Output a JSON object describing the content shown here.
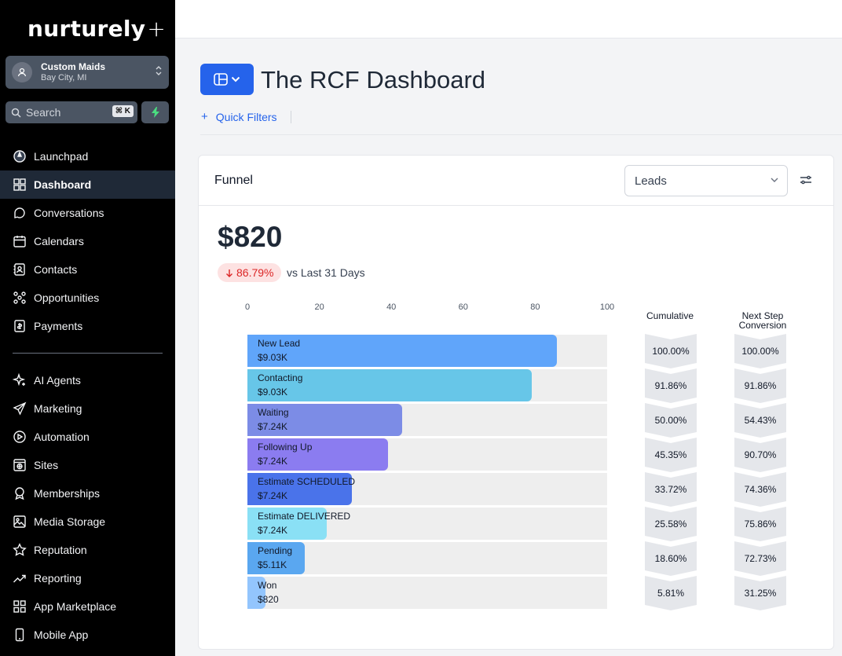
{
  "brand": {
    "logo_text": "nurturely",
    "logo_plus": "+"
  },
  "account": {
    "name": "Custom Maids",
    "location": "Bay City, MI"
  },
  "search": {
    "placeholder": "Search",
    "shortcut": "⌘ K"
  },
  "nav": {
    "primary": [
      {
        "label": "Launchpad",
        "icon": "launchpad-icon"
      },
      {
        "label": "Dashboard",
        "icon": "dashboard-icon",
        "active": true
      },
      {
        "label": "Conversations",
        "icon": "chat-icon"
      },
      {
        "label": "Calendars",
        "icon": "calendar-icon"
      },
      {
        "label": "Contacts",
        "icon": "contacts-icon"
      },
      {
        "label": "Opportunities",
        "icon": "opportunities-icon"
      },
      {
        "label": "Payments",
        "icon": "payments-icon"
      }
    ],
    "secondary": [
      {
        "label": "AI Agents",
        "icon": "sparkle-icon"
      },
      {
        "label": "Marketing",
        "icon": "send-icon"
      },
      {
        "label": "Automation",
        "icon": "automation-icon"
      },
      {
        "label": "Sites",
        "icon": "sites-icon"
      },
      {
        "label": "Memberships",
        "icon": "badge-icon"
      },
      {
        "label": "Media Storage",
        "icon": "image-icon"
      },
      {
        "label": "Reputation",
        "icon": "star-icon"
      },
      {
        "label": "Reporting",
        "icon": "trend-icon"
      },
      {
        "label": "App Marketplace",
        "icon": "apps-icon"
      },
      {
        "label": "Mobile App",
        "icon": "mobile-icon"
      }
    ]
  },
  "page": {
    "title": "The RCF Dashboard",
    "quick_filters": "Quick Filters"
  },
  "card": {
    "title": "Funnel",
    "select_value": "Leads",
    "metric": "$820",
    "change": "86.79%",
    "change_direction": "down",
    "comparison": "vs Last 31 Days",
    "col_cumulative": "Cumulative",
    "col_next_step_1": "Next Step",
    "col_next_step_2": "Conversion"
  },
  "colors": {
    "accent": "#2563eb",
    "negative": "#dc2626",
    "stages": [
      "#60a5fa",
      "#67c6e8",
      "#7c8ce6",
      "#8b7cf0",
      "#4a73ea",
      "#8ae0f5",
      "#5aa7f0",
      "#93c5fd"
    ]
  },
  "chart_data": {
    "type": "bar",
    "orientation": "horizontal",
    "x_ticks": [
      "0",
      "20",
      "40",
      "60",
      "80",
      "100"
    ],
    "xlim": [
      0,
      100
    ],
    "stages": [
      {
        "name": "New Lead",
        "amount": "$9.03K",
        "value": 86,
        "cumulative": "100.00%",
        "next_step": "100.00%"
      },
      {
        "name": "Contacting",
        "amount": "$9.03K",
        "value": 79,
        "cumulative": "91.86%",
        "next_step": "91.86%"
      },
      {
        "name": "Waiting",
        "amount": "$7.24K",
        "value": 43,
        "cumulative": "50.00%",
        "next_step": "54.43%"
      },
      {
        "name": "Following Up",
        "amount": "$7.24K",
        "value": 39,
        "cumulative": "45.35%",
        "next_step": "90.70%"
      },
      {
        "name": "Estimate SCHEDULED",
        "amount": "$7.24K",
        "value": 29,
        "cumulative": "33.72%",
        "next_step": "74.36%"
      },
      {
        "name": "Estimate DELIVERED",
        "amount": "$7.24K",
        "value": 22,
        "cumulative": "25.58%",
        "next_step": "75.86%"
      },
      {
        "name": "Pending",
        "amount": "$5.11K",
        "value": 16,
        "cumulative": "18.60%",
        "next_step": "72.73%"
      },
      {
        "name": "Won",
        "amount": "$820",
        "value": 5,
        "cumulative": "5.81%",
        "next_step": "31.25%"
      }
    ]
  }
}
